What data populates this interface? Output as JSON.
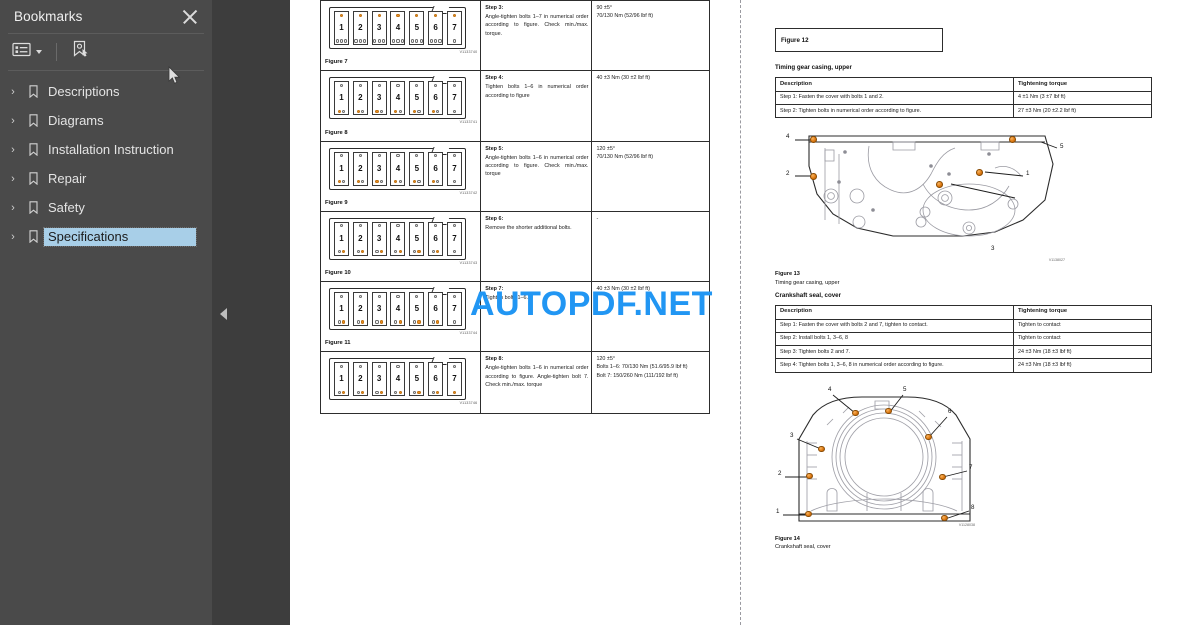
{
  "sidebar": {
    "title": "Bookmarks",
    "close_icon": "close-icon",
    "toolbar": {
      "options_label": "",
      "options_icon": "list-options-icon",
      "dropdown_icon": "chevron-down-icon",
      "new_bookmark_icon": "new-bookmark-icon"
    },
    "items": [
      {
        "label": "Descriptions",
        "expander": "›",
        "selected": false
      },
      {
        "label": "Diagrams",
        "expander": "›",
        "selected": false
      },
      {
        "label": "Installation Instruction",
        "expander": "›",
        "selected": false
      },
      {
        "label": "Repair",
        "expander": "›",
        "selected": false
      },
      {
        "label": "Safety",
        "expander": "›",
        "selected": false
      },
      {
        "label": "Specifications",
        "expander": "›",
        "selected": true
      }
    ],
    "collapse_icon": "collapse-panel-arrow-icon"
  },
  "watermark": {
    "text": "AUTOPDF.NET",
    "color": "#2196f3"
  },
  "left_page": {
    "rows": [
      {
        "figure_caption": "Figure 7",
        "image_code": "V1133740",
        "bolt_numbers": [
          "1",
          "2",
          "3",
          "4",
          "5",
          "6",
          "7"
        ],
        "step_title": "Step 3:",
        "step_body": "Angle-tighten bolts 1–7 in numerical order according to figure. Check min./max. torque.",
        "torque": [
          "90 ±5°",
          "70/130 Nm (52/96 lbf ft)"
        ]
      },
      {
        "figure_caption": "Figure 8",
        "image_code": "V1133741",
        "bolt_numbers": [
          "1",
          "2",
          "3",
          "4",
          "5",
          "6",
          "7"
        ],
        "step_title": "Step 4:",
        "step_body": "Tighten bolts 1–6 in numerical order according to figure",
        "torque": [
          "40 ±3 Nm (30 ±2 lbf ft)"
        ]
      },
      {
        "figure_caption": "Figure 9",
        "image_code": "V1133742",
        "bolt_numbers": [
          "1",
          "2",
          "3",
          "4",
          "5",
          "6",
          "7"
        ],
        "step_title": "Step 5:",
        "step_body": "Angle-tighten bolts 1–6 in numerical order according to figure. Check min./max. torque",
        "torque": [
          "120 ±5°",
          "70/130 Nm (52/96 lbf ft)"
        ]
      },
      {
        "figure_caption": "Figure 10",
        "image_code": "V1133743",
        "bolt_numbers": [
          "1",
          "2",
          "3",
          "4",
          "5",
          "6",
          "7"
        ],
        "step_title": "Step 6:",
        "step_body": "Remove the shorter additional bolts.",
        "torque": [
          "-"
        ]
      },
      {
        "figure_caption": "Figure 11",
        "image_code": "V1133744",
        "bolt_numbers": [
          "1",
          "2",
          "3",
          "4",
          "5",
          "6",
          "7"
        ],
        "step_title": "Step 7:",
        "step_body": "Tighten bolts 1–6.",
        "torque": [
          "40 ±3 Nm (30 ±2 lbf ft)"
        ]
      },
      {
        "figure_caption": "",
        "image_code": "V1133746",
        "bolt_numbers": [
          "1",
          "2",
          "3",
          "4",
          "5",
          "6",
          "7"
        ],
        "step_title": "Step 8:",
        "step_body": "Angle-tighten bolts 1–6 in numerical order according to figure. Angle-tighten bolt 7. Check min./max. torque",
        "torque": [
          "120 ±5°",
          "Bolts 1–6: 70/130 Nm (51.6/95.9 lbf ft)",
          "Bolt 7: 150/260 Nm (111/192 lbf ft)"
        ]
      }
    ]
  },
  "right_page": {
    "figure_box_label": "Figure 12",
    "section1": {
      "title": "Timing gear casing, upper",
      "headers": [
        "Description",
        "Tightening torque"
      ],
      "rows": [
        [
          "Step 1: Fasten the cover with bolts 1 and 2.",
          "4 ±1 Nm (3 ±7 lbf ft)"
        ],
        [
          "Step 2: Tighten bolts in numerical order according to figure.",
          "27 ±3 Nm (20 ±2.2 lbf ft)"
        ]
      ]
    },
    "figure13": {
      "caption_line1": "Figure 13",
      "caption_line2": "Timing gear casing, upper",
      "image_code": "V1138027",
      "callouts": [
        "1",
        "2",
        "3",
        "4",
        "5"
      ]
    },
    "section2": {
      "title": "Crankshaft seal, cover",
      "headers": [
        "Description",
        "Tightening torque"
      ],
      "rows": [
        [
          "Step 1: Fasten the cover with bolts 2 and 7, tighten to contact.",
          "Tighten to contact"
        ],
        [
          "Step 2: Install bolts 1, 3–6, 8",
          "Tighten to contact"
        ],
        [
          "Step 3: Tighten bolts 2 and 7.",
          "24 ±3 Nm (18 ±3 lbf ft)"
        ],
        [
          "Step 4: Tighten bolts 1, 3–6, 8 in numerical order according to figure.",
          "24 ±3 Nm (18 ±3 lbf ft)"
        ]
      ]
    },
    "figure14": {
      "caption_line1": "Figure 14",
      "caption_line2": "Crankshaft seal, cover",
      "image_code": "V1128038",
      "callouts": [
        "1",
        "2",
        "3",
        "4",
        "5",
        "6",
        "7",
        "8"
      ]
    }
  }
}
